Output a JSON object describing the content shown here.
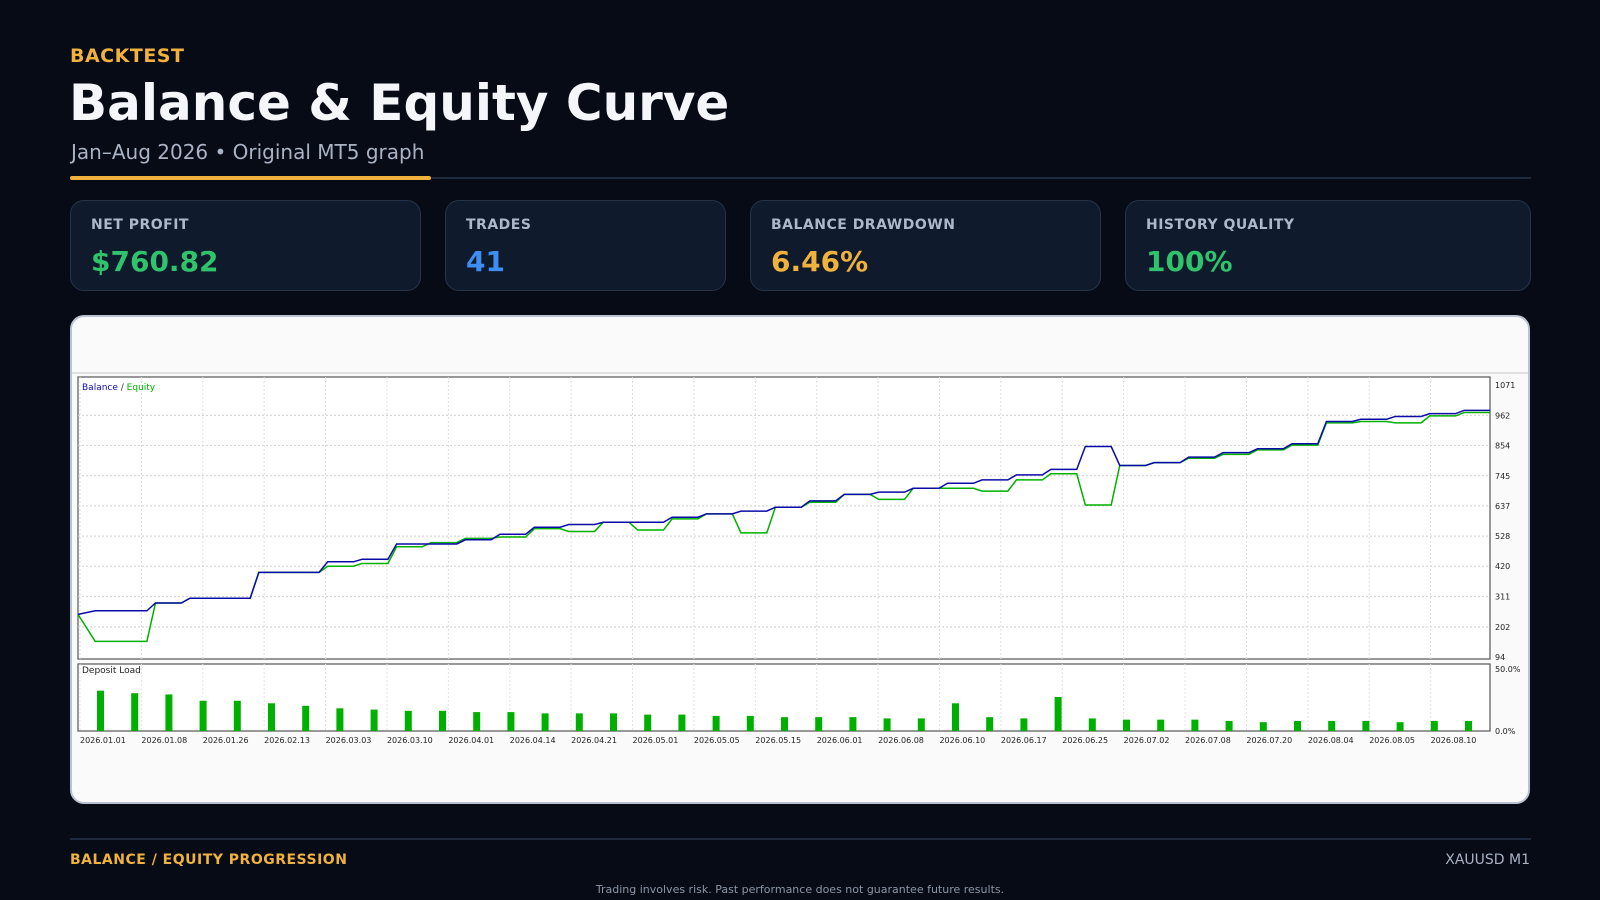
{
  "header": {
    "kicker": "BACKTEST",
    "title": "Balance & Equity Curve",
    "subtitle": "Jan–Aug 2026 • Original MT5 graph"
  },
  "stats": [
    {
      "label": "NET PROFIT",
      "value": "$760.82",
      "color": "#2fc46b"
    },
    {
      "label": "TRADES",
      "value": "41",
      "color": "#3d8ef0"
    },
    {
      "label": "BALANCE DRAWDOWN",
      "value": "6.46%",
      "color": "#f0b23c"
    },
    {
      "label": "HISTORY QUALITY",
      "value": "100%",
      "color": "#2fc46b"
    }
  ],
  "chart_data": [
    {
      "type": "line",
      "legend": [
        "Balance",
        "Equity"
      ],
      "legend_colors": [
        "#0b0ba8",
        "#00b000"
      ],
      "y_ticks": [
        "1071",
        "962",
        "854",
        "745",
        "637",
        "528",
        "420",
        "311",
        "202",
        "94"
      ],
      "ylim": [
        94,
        1071
      ],
      "x_ticks": [
        "2026.01.01",
        "2026.01.08",
        "2026.01.26",
        "2026.02.13",
        "2026.03.03",
        "2026.03.10",
        "2026.04.01",
        "2026.04.14",
        "2026.04.21",
        "2026.05.01",
        "2026.05.05",
        "2026.05.15",
        "2026.06.01",
        "2026.06.08",
        "2026.06.10",
        "2026.06.17",
        "2026.06.25",
        "2026.07.02",
        "2026.07.08",
        "2026.07.20",
        "2026.08.04",
        "2026.08.05",
        "2026.08.10"
      ],
      "x": [
        0,
        2,
        3,
        4,
        5,
        6,
        7,
        8,
        9,
        10,
        11,
        12,
        13,
        14,
        15,
        16,
        17,
        18,
        19,
        20,
        21,
        22,
        23,
        24,
        25,
        26,
        27,
        28,
        29,
        30,
        31,
        32,
        33,
        34,
        35,
        36,
        37,
        38,
        39,
        40,
        41
      ],
      "series": [
        {
          "name": "Balance",
          "values": [
            247,
            260,
            288,
            305,
            305,
            398,
            398,
            436,
            445,
            500,
            500,
            515,
            535,
            560,
            570,
            578,
            578,
            596,
            608,
            618,
            632,
            655,
            678,
            686,
            700,
            718,
            730,
            748,
            768,
            850,
            782,
            792,
            812,
            828,
            842,
            860,
            940,
            948,
            958,
            968,
            980
          ]
        },
        {
          "name": "Equity",
          "values": [
            247,
            150,
            288,
            305,
            305,
            398,
            398,
            420,
            430,
            490,
            505,
            520,
            525,
            555,
            545,
            578,
            550,
            590,
            608,
            540,
            632,
            650,
            678,
            660,
            700,
            700,
            690,
            730,
            752,
            640,
            782,
            792,
            808,
            822,
            838,
            855,
            935,
            940,
            935,
            960,
            972
          ]
        }
      ]
    },
    {
      "type": "bar",
      "title": "Deposit Load",
      "y_ticks": [
        "50.0%",
        "0.0%"
      ],
      "ylim": [
        0,
        50
      ],
      "x": [
        0,
        1,
        2,
        3,
        4,
        5,
        6,
        7,
        8,
        9,
        10,
        11,
        12,
        13,
        14,
        15,
        16,
        17,
        18,
        19,
        20,
        21,
        22,
        23,
        24,
        25,
        26,
        27,
        28,
        29,
        30,
        31,
        32,
        33,
        34,
        35,
        36,
        37,
        38,
        39,
        40
      ],
      "values": [
        32,
        30,
        29,
        24,
        24,
        22,
        20,
        18,
        17,
        16,
        16,
        15,
        15,
        14,
        14,
        14,
        13,
        13,
        12,
        12,
        11,
        11,
        11,
        10,
        10,
        22,
        11,
        10,
        27,
        10,
        9,
        9,
        9,
        8,
        7,
        8,
        8,
        8,
        7,
        8,
        8
      ]
    }
  ],
  "footer": {
    "left": "BALANCE / EQUITY PROGRESSION",
    "right": "XAUUSD M1",
    "disclaimer": "Trading involves risk. Past performance does not guarantee future results."
  }
}
